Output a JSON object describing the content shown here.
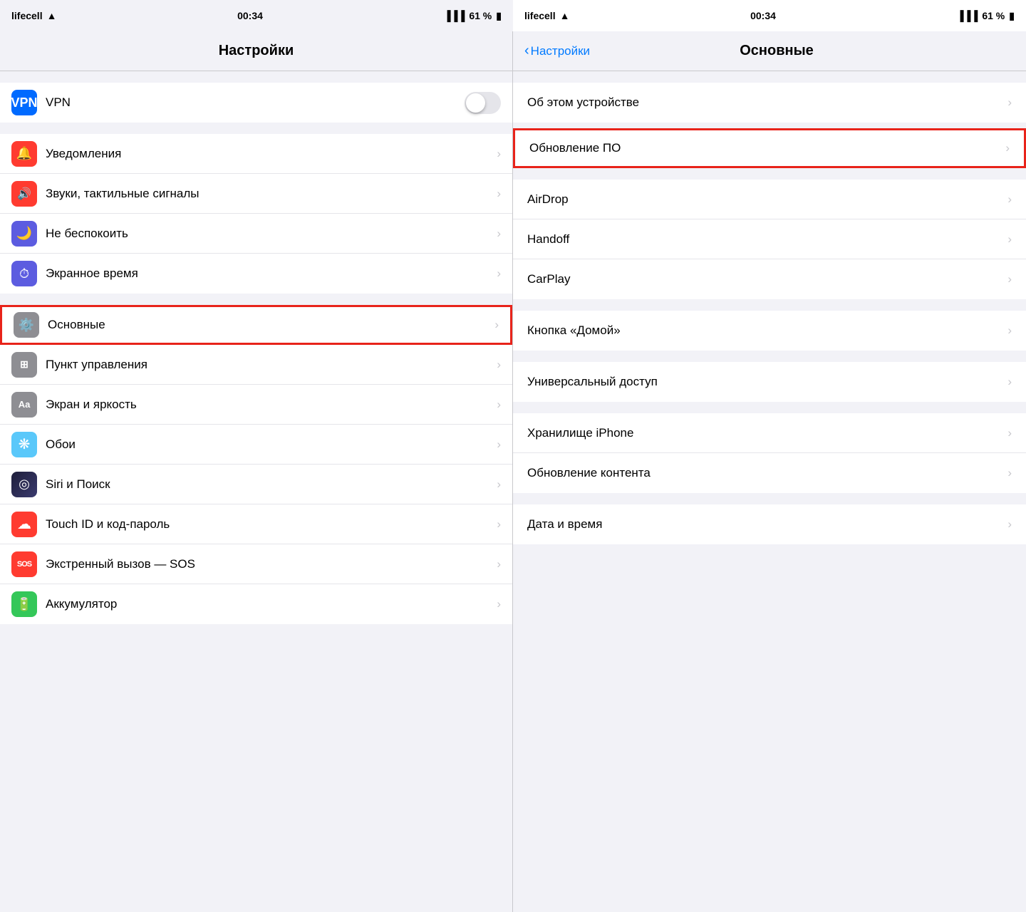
{
  "left": {
    "status": {
      "carrier": "lifecell",
      "time": "00:34",
      "battery": "61 %"
    },
    "title": "Настройки",
    "vpn": {
      "label": "VPN",
      "icon_text": "VPN"
    },
    "groups": [
      {
        "id": "notifications-group",
        "items": [
          {
            "id": "notifications",
            "icon_color": "red",
            "icon_emoji": "🔔",
            "label": "Уведомления",
            "chevron": "›"
          },
          {
            "id": "sounds",
            "icon_color": "red",
            "icon_emoji": "🔊",
            "label": "Звуки, тактильные сигналы",
            "chevron": "›"
          },
          {
            "id": "dnd",
            "icon_color": "indigo",
            "icon_emoji": "🌙",
            "label": "Не беспокоить",
            "chevron": "›"
          },
          {
            "id": "screentime",
            "icon_color": "indigo",
            "icon_emoji": "⏱",
            "label": "Экранное время",
            "chevron": "›"
          }
        ]
      },
      {
        "id": "general-group",
        "items": [
          {
            "id": "general",
            "icon_color": "gray",
            "icon_emoji": "⚙️",
            "label": "Основные",
            "chevron": "›",
            "highlighted": true
          },
          {
            "id": "control-center",
            "icon_color": "gray",
            "icon_emoji": "⊞",
            "label": "Пункт управления",
            "chevron": "›"
          },
          {
            "id": "display",
            "icon_color": "gray",
            "icon_emoji": "Aa",
            "label": "Экран и яркость",
            "chevron": "›"
          },
          {
            "id": "wallpaper",
            "icon_color": "teal",
            "icon_emoji": "❋",
            "label": "Обои",
            "chevron": "›"
          },
          {
            "id": "siri",
            "icon_color": "siri",
            "icon_emoji": "◎",
            "label": "Siri и Поиск",
            "chevron": "›"
          },
          {
            "id": "touchid",
            "icon_color": "red",
            "icon_emoji": "☁",
            "label": "Touch ID и код-пароль",
            "chevron": "›"
          },
          {
            "id": "sos",
            "icon_color": "red",
            "icon_emoji": "SOS",
            "label": "Экстренный вызов — SOS",
            "chevron": "›"
          },
          {
            "id": "battery",
            "icon_color": "green",
            "icon_emoji": "🔋",
            "label": "Аккумулятор",
            "chevron": "›"
          }
        ]
      }
    ]
  },
  "right": {
    "status": {
      "carrier": "lifecell",
      "time": "00:34",
      "battery": "61 %"
    },
    "back_label": "Настройки",
    "title": "Основные",
    "groups": [
      {
        "id": "top-group",
        "items": [
          {
            "id": "about",
            "label": "Об этом устройстве",
            "chevron": "›"
          }
        ]
      },
      {
        "id": "update-group",
        "items": [
          {
            "id": "software-update",
            "label": "Обновление ПО",
            "chevron": "›",
            "highlighted": true
          }
        ]
      },
      {
        "id": "connectivity-group",
        "items": [
          {
            "id": "airdrop",
            "label": "AirDrop",
            "chevron": "›"
          },
          {
            "id": "handoff",
            "label": "Handoff",
            "chevron": "›"
          },
          {
            "id": "carplay",
            "label": "CarPlay",
            "chevron": "›"
          }
        ]
      },
      {
        "id": "home-group",
        "items": [
          {
            "id": "home-button",
            "label": "Кнопка «Домой»",
            "chevron": "›"
          }
        ]
      },
      {
        "id": "accessibility-group",
        "items": [
          {
            "id": "accessibility",
            "label": "Универсальный доступ",
            "chevron": "›"
          }
        ]
      },
      {
        "id": "storage-group",
        "items": [
          {
            "id": "iphone-storage",
            "label": "Хранилище iPhone",
            "chevron": "›"
          },
          {
            "id": "bg-refresh",
            "label": "Обновление контента",
            "chevron": "›"
          }
        ]
      },
      {
        "id": "datetime-group",
        "items": [
          {
            "id": "datetime",
            "label": "Дата и время",
            "chevron": "›"
          }
        ]
      }
    ]
  }
}
